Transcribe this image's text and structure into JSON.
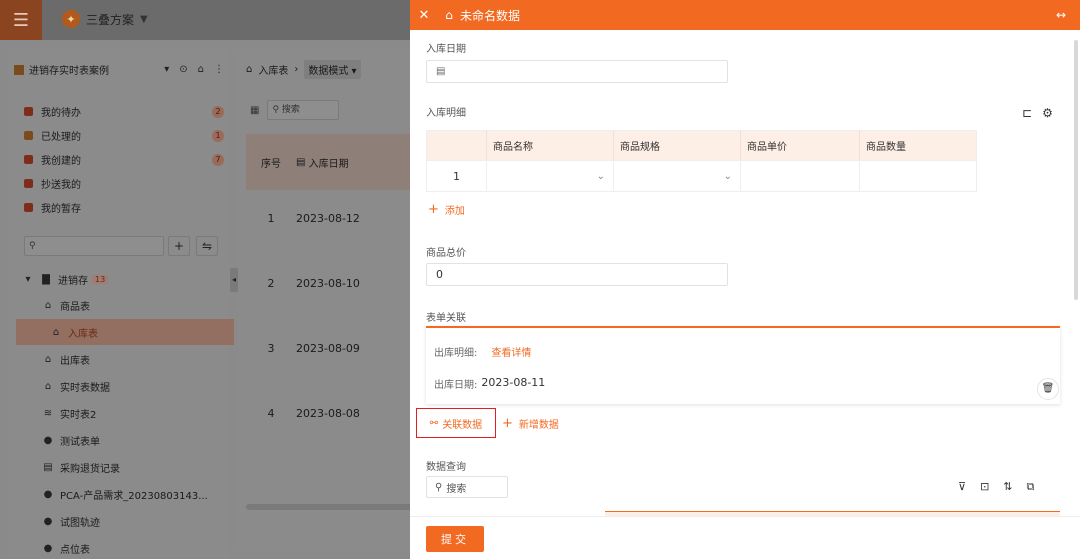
{
  "app": {
    "name": "三叠方案"
  },
  "left_panel": {
    "title": "进销存实时表案例",
    "nav": [
      {
        "label": "我的待办",
        "count": "2",
        "color": "#7e2d1d"
      },
      {
        "label": "已处理的",
        "count": "1",
        "color": "#7a4b1c"
      },
      {
        "label": "我创建的",
        "count": "7",
        "color": "#7e2d1d"
      },
      {
        "label": "抄送我的",
        "count": "",
        "color": "#7e2d1d"
      },
      {
        "label": "我的暂存",
        "count": "",
        "color": "#7e2d1d"
      }
    ],
    "search_placeholder": "",
    "tree_root": {
      "label": "进销存",
      "badge": "13"
    },
    "tree_items": [
      {
        "label": "商品表",
        "icon": "home-icon"
      },
      {
        "label": "入库表",
        "icon": "home-icon",
        "active": true
      },
      {
        "label": "出库表",
        "icon": "home-icon"
      },
      {
        "label": "实时表数据",
        "icon": "home-icon"
      },
      {
        "label": "实时表2",
        "icon": "db-icon"
      },
      {
        "label": "测试表单",
        "icon": "user-icon"
      },
      {
        "label": "采购退货记录",
        "icon": "list-icon"
      },
      {
        "label": "PCA-产品需求_20230803143...",
        "icon": "user-icon"
      },
      {
        "label": "试图轨迹",
        "icon": "user-icon"
      },
      {
        "label": "点位表",
        "icon": "user-icon"
      }
    ]
  },
  "mid_panel": {
    "breadcrumb": "入库表",
    "mode": "数据模式",
    "search_placeholder": "搜索",
    "col_no": "序号",
    "col_date": "入库日期",
    "rows": [
      {
        "no": "1",
        "date": "2023-08-12"
      },
      {
        "no": "2",
        "date": "2023-08-10"
      },
      {
        "no": "3",
        "date": "2023-08-09"
      },
      {
        "no": "4",
        "date": "2023-08-08"
      }
    ]
  },
  "drawer": {
    "title": "未命名数据",
    "fields": {
      "date_label": "入库日期",
      "date_value": "",
      "detail_label": "入库明细",
      "total_label": "商品总价",
      "total_value": "0",
      "relation_label": "表单关联",
      "query_label": "数据查询"
    },
    "detail_table": {
      "headers": [
        "",
        "商品名称",
        "商品规格",
        "商品单价",
        "商品数量"
      ],
      "rows": [
        {
          "no": "1",
          "name": "",
          "spec": "",
          "price": "",
          "qty": ""
        }
      ]
    },
    "add_label": "添加",
    "relation": {
      "detail_key": "出库明细:",
      "detail_link": "查看详情",
      "date_key": "出库日期:",
      "date_value": "2023-08-11"
    },
    "assoc_button": "关联数据",
    "new_button": "新增数据",
    "query_search_placeholder": "搜索",
    "submit_label": "提交"
  },
  "colors": {
    "accent": "#f26a21",
    "highlight_border": "#e02020",
    "header_tint": "#fdeee6"
  }
}
